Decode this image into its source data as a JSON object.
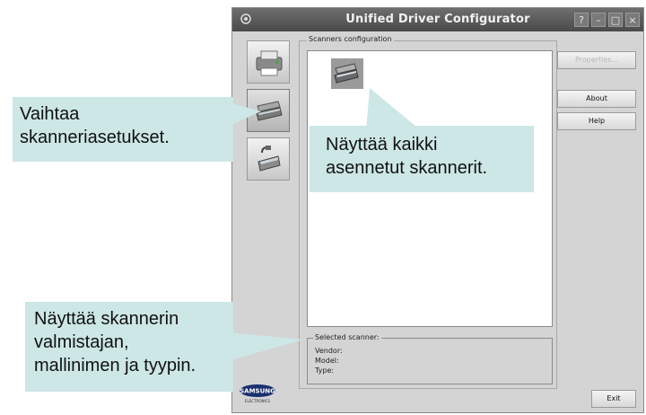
{
  "window": {
    "title": "Unified Driver Configurator",
    "controls": [
      "?",
      "–",
      "□",
      "×"
    ]
  },
  "sidebar": {
    "items": [
      {
        "name": "printers",
        "icon": "printer-icon",
        "active": false
      },
      {
        "name": "scanners",
        "icon": "scanner-icon",
        "active": true
      },
      {
        "name": "ports",
        "icon": "port-icon",
        "active": false
      }
    ]
  },
  "scanners_config": {
    "group_label": "Scanners configuration",
    "items": [
      {
        "icon": "scanner-icon"
      }
    ]
  },
  "selected_scanner": {
    "label": "Selected scanner:",
    "vendor_label": "Vendor:",
    "model_label": "Model:",
    "type_label": "Type:"
  },
  "buttons": {
    "properties": {
      "label": "Properties...",
      "enabled": false
    },
    "about": {
      "label": "About"
    },
    "help": {
      "label": "Help"
    },
    "exit": {
      "label": "Exit"
    }
  },
  "logo": {
    "brand": "SAMSUNG",
    "sub": "ELECTRONICS"
  },
  "callouts": {
    "left_top": {
      "line1": "Vaihtaa",
      "line2": "skanneriasetukset."
    },
    "middle": {
      "line1": "Näyttää kaikki",
      "line2": "asennetut skannerit."
    },
    "left_bottom": {
      "line1": "Näyttää skannerin",
      "line2": "valmistajan,",
      "line3": "mallinimen ja tyypin."
    }
  },
  "colors": {
    "callout_bg": "#cde6e6",
    "titlebar": "#555555",
    "window_bg": "#d4d4d4"
  }
}
